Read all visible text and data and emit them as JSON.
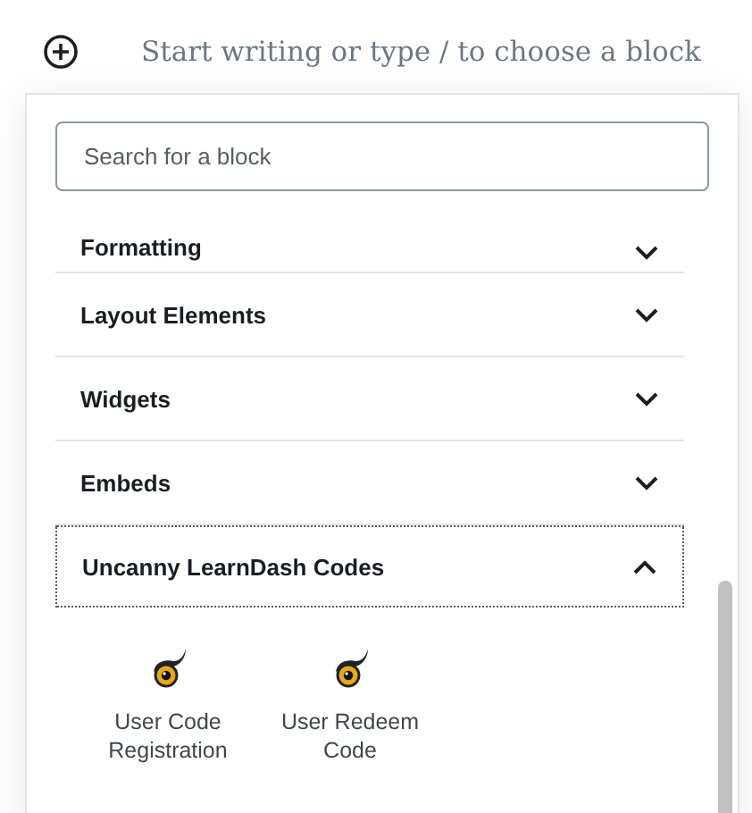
{
  "editor": {
    "placeholder": "Start writing or type / to choose a block"
  },
  "inserter": {
    "search": {
      "placeholder": "Search for a block"
    },
    "panels": [
      {
        "label": "Formatting",
        "expanded": false,
        "focused": false
      },
      {
        "label": "Layout Elements",
        "expanded": false,
        "focused": false
      },
      {
        "label": "Widgets",
        "expanded": false,
        "focused": false
      },
      {
        "label": "Embeds",
        "expanded": false,
        "focused": false
      },
      {
        "label": "Uncanny LearnDash Codes",
        "expanded": true,
        "focused": true,
        "blocks": [
          {
            "label": "User Code Registration"
          },
          {
            "label": "User Redeem Code"
          }
        ]
      }
    ]
  }
}
